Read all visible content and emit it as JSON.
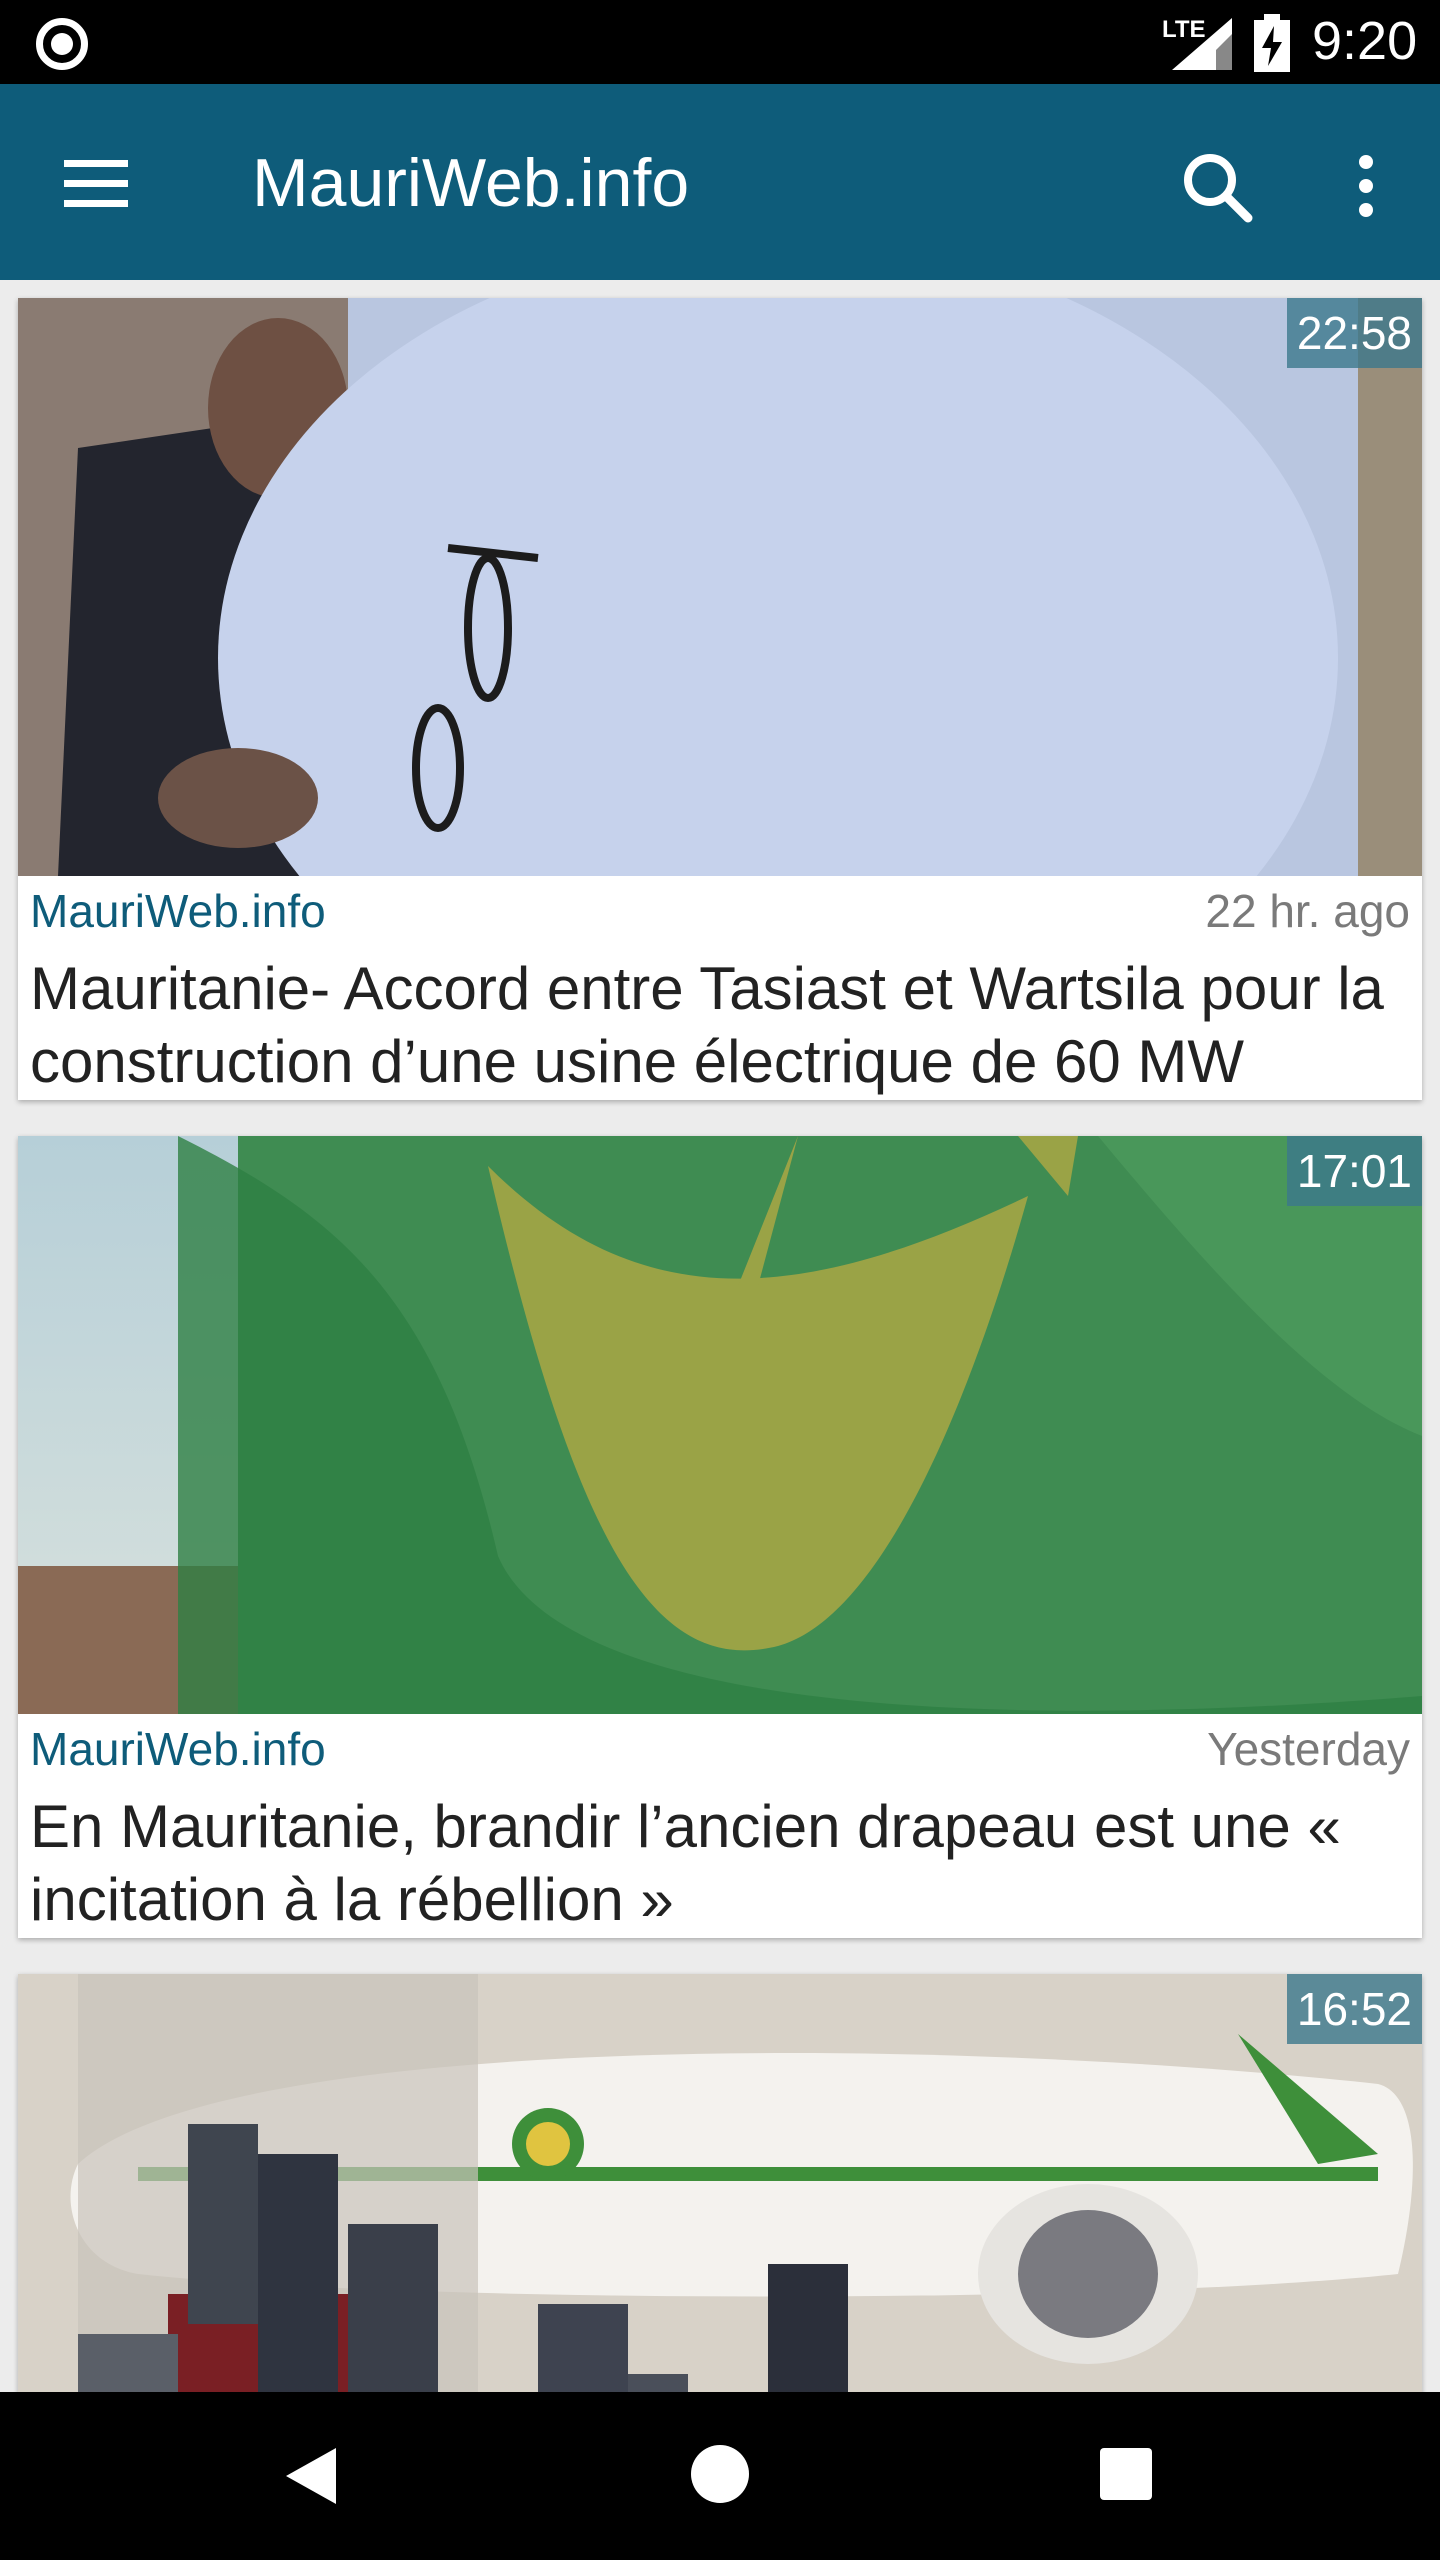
{
  "status_bar": {
    "network": "LTE",
    "time": "9:20"
  },
  "app_bar": {
    "title": "MauriWeb.info"
  },
  "articles": [
    {
      "time": "22:58",
      "source": "MauriWeb.info",
      "ago": "22 hr. ago",
      "headline": "Mauritanie- Accord entre Tasiast et Wartsila pour la construction d’une usine électrique de 60 MW"
    },
    {
      "time": "17:01",
      "source": "MauriWeb.info",
      "ago": "Yesterday",
      "headline": "En Mauritanie, brandir l’ancien drapeau est une « incitation à la rébellion »"
    },
    {
      "time": "16:52"
    }
  ],
  "colors": {
    "app_bar": "#0e5c7a",
    "source_link": "#0e5c7a",
    "timestamp_badge": "#3c788c"
  },
  "icons": {
    "menu": "hamburger-icon",
    "search": "search-icon",
    "more": "more-vert-icon",
    "back": "back-icon",
    "home": "home-icon",
    "recents": "recents-icon"
  }
}
